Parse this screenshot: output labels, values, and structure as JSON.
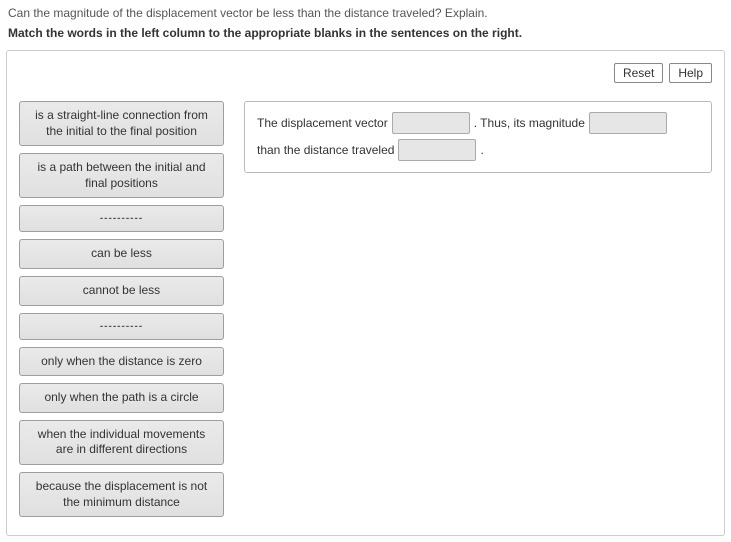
{
  "header": {
    "question": "Can the magnitude of the displacement vector be less than the distance traveled? Explain.",
    "instruction": "Match the words in the left column to the appropriate blanks in the sentences on the right."
  },
  "toolbar": {
    "reset_label": "Reset",
    "help_label": "Help"
  },
  "bank": {
    "items": [
      "is a straight-line connection from the initial to the final position",
      "is a path between the initial and final positions",
      "----------",
      "can be less",
      "cannot be less",
      "----------",
      "only when the distance is zero",
      "only when the path is a circle",
      "when the individual movements are in different directions",
      "because the displacement is not the minimum distance"
    ]
  },
  "sentence": {
    "seg1": "The displacement vector",
    "seg2": ". Thus, its magnitude",
    "seg3": "than the distance traveled",
    "seg4": "."
  }
}
